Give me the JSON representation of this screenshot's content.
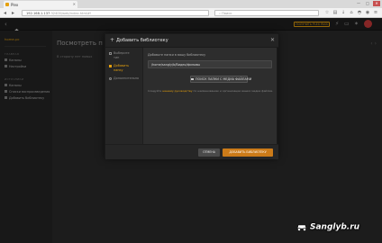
{
  "browser": {
    "tab_title": "Plex",
    "url_host": "192.168.1.137",
    "url_path": ":32400/web/index.html#!",
    "search_placeholder": "Поиск",
    "window_controls": [
      "—",
      "□",
      "✕"
    ]
  },
  "plex": {
    "premium_label": "ПОЛУЧИТЬ PLEX PASS",
    "server_name": "home-pc",
    "sidebar_sections": [
      {
        "title": "ГЛАВНАЯ",
        "items": [
          "Каналы",
          "Настройки"
        ]
      },
      {
        "title": "ИСТОЧНИКИ",
        "items": [
          "Каналы",
          "Списки воспроизведения",
          "Добавить библиотеку"
        ]
      }
    ],
    "main_title": "Посмотреть п",
    "main_note": "В сторону нет новых"
  },
  "modal": {
    "title": "Добавить библиотеку",
    "close_glyph": "✕",
    "steps": [
      {
        "lines": [
          "Выберите",
          "тип"
        ],
        "active": false
      },
      {
        "lines": [
          "Добавить",
          "папку"
        ],
        "active": true
      },
      {
        "lines": [
          "Дополнительно"
        ],
        "active": false
      }
    ],
    "path_label": "Добавьте папки в вашу библиотеку",
    "path_value": "/home/sangly/b/Видео/фильмы",
    "browse_label": "ПОИСК ПАПКИ С МЕДИА ФАЙЛАМИ",
    "help_before": "Следуйте ",
    "help_link": "нашему руководству",
    "help_after": " по наименованию и организации ваших медиа файлов.",
    "cancel_label": "ОТМЕНА",
    "add_label": "ДОБАВИТЬ БИБЛИОТЕКУ"
  },
  "watermark": "Sanglyb.ru",
  "colors": {
    "accent": "#e5a00d",
    "add_button": "#cc7b19",
    "background": "#2b2b2b"
  }
}
